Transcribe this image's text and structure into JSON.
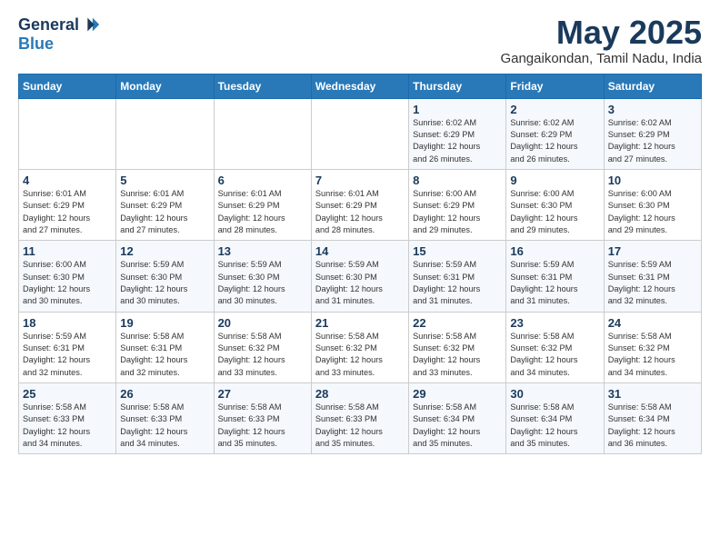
{
  "header": {
    "logo_general": "General",
    "logo_blue": "Blue",
    "title": "May 2025",
    "location": "Gangaikondan, Tamil Nadu, India"
  },
  "days_of_week": [
    "Sunday",
    "Monday",
    "Tuesday",
    "Wednesday",
    "Thursday",
    "Friday",
    "Saturday"
  ],
  "weeks": [
    [
      {
        "num": "",
        "info": ""
      },
      {
        "num": "",
        "info": ""
      },
      {
        "num": "",
        "info": ""
      },
      {
        "num": "",
        "info": ""
      },
      {
        "num": "1",
        "info": "Sunrise: 6:02 AM\nSunset: 6:29 PM\nDaylight: 12 hours\nand 26 minutes."
      },
      {
        "num": "2",
        "info": "Sunrise: 6:02 AM\nSunset: 6:29 PM\nDaylight: 12 hours\nand 26 minutes."
      },
      {
        "num": "3",
        "info": "Sunrise: 6:02 AM\nSunset: 6:29 PM\nDaylight: 12 hours\nand 27 minutes."
      }
    ],
    [
      {
        "num": "4",
        "info": "Sunrise: 6:01 AM\nSunset: 6:29 PM\nDaylight: 12 hours\nand 27 minutes."
      },
      {
        "num": "5",
        "info": "Sunrise: 6:01 AM\nSunset: 6:29 PM\nDaylight: 12 hours\nand 27 minutes."
      },
      {
        "num": "6",
        "info": "Sunrise: 6:01 AM\nSunset: 6:29 PM\nDaylight: 12 hours\nand 28 minutes."
      },
      {
        "num": "7",
        "info": "Sunrise: 6:01 AM\nSunset: 6:29 PM\nDaylight: 12 hours\nand 28 minutes."
      },
      {
        "num": "8",
        "info": "Sunrise: 6:00 AM\nSunset: 6:29 PM\nDaylight: 12 hours\nand 29 minutes."
      },
      {
        "num": "9",
        "info": "Sunrise: 6:00 AM\nSunset: 6:30 PM\nDaylight: 12 hours\nand 29 minutes."
      },
      {
        "num": "10",
        "info": "Sunrise: 6:00 AM\nSunset: 6:30 PM\nDaylight: 12 hours\nand 29 minutes."
      }
    ],
    [
      {
        "num": "11",
        "info": "Sunrise: 6:00 AM\nSunset: 6:30 PM\nDaylight: 12 hours\nand 30 minutes."
      },
      {
        "num": "12",
        "info": "Sunrise: 5:59 AM\nSunset: 6:30 PM\nDaylight: 12 hours\nand 30 minutes."
      },
      {
        "num": "13",
        "info": "Sunrise: 5:59 AM\nSunset: 6:30 PM\nDaylight: 12 hours\nand 30 minutes."
      },
      {
        "num": "14",
        "info": "Sunrise: 5:59 AM\nSunset: 6:30 PM\nDaylight: 12 hours\nand 31 minutes."
      },
      {
        "num": "15",
        "info": "Sunrise: 5:59 AM\nSunset: 6:31 PM\nDaylight: 12 hours\nand 31 minutes."
      },
      {
        "num": "16",
        "info": "Sunrise: 5:59 AM\nSunset: 6:31 PM\nDaylight: 12 hours\nand 31 minutes."
      },
      {
        "num": "17",
        "info": "Sunrise: 5:59 AM\nSunset: 6:31 PM\nDaylight: 12 hours\nand 32 minutes."
      }
    ],
    [
      {
        "num": "18",
        "info": "Sunrise: 5:59 AM\nSunset: 6:31 PM\nDaylight: 12 hours\nand 32 minutes."
      },
      {
        "num": "19",
        "info": "Sunrise: 5:58 AM\nSunset: 6:31 PM\nDaylight: 12 hours\nand 32 minutes."
      },
      {
        "num": "20",
        "info": "Sunrise: 5:58 AM\nSunset: 6:32 PM\nDaylight: 12 hours\nand 33 minutes."
      },
      {
        "num": "21",
        "info": "Sunrise: 5:58 AM\nSunset: 6:32 PM\nDaylight: 12 hours\nand 33 minutes."
      },
      {
        "num": "22",
        "info": "Sunrise: 5:58 AM\nSunset: 6:32 PM\nDaylight: 12 hours\nand 33 minutes."
      },
      {
        "num": "23",
        "info": "Sunrise: 5:58 AM\nSunset: 6:32 PM\nDaylight: 12 hours\nand 34 minutes."
      },
      {
        "num": "24",
        "info": "Sunrise: 5:58 AM\nSunset: 6:32 PM\nDaylight: 12 hours\nand 34 minutes."
      }
    ],
    [
      {
        "num": "25",
        "info": "Sunrise: 5:58 AM\nSunset: 6:33 PM\nDaylight: 12 hours\nand 34 minutes."
      },
      {
        "num": "26",
        "info": "Sunrise: 5:58 AM\nSunset: 6:33 PM\nDaylight: 12 hours\nand 34 minutes."
      },
      {
        "num": "27",
        "info": "Sunrise: 5:58 AM\nSunset: 6:33 PM\nDaylight: 12 hours\nand 35 minutes."
      },
      {
        "num": "28",
        "info": "Sunrise: 5:58 AM\nSunset: 6:33 PM\nDaylight: 12 hours\nand 35 minutes."
      },
      {
        "num": "29",
        "info": "Sunrise: 5:58 AM\nSunset: 6:34 PM\nDaylight: 12 hours\nand 35 minutes."
      },
      {
        "num": "30",
        "info": "Sunrise: 5:58 AM\nSunset: 6:34 PM\nDaylight: 12 hours\nand 35 minutes."
      },
      {
        "num": "31",
        "info": "Sunrise: 5:58 AM\nSunset: 6:34 PM\nDaylight: 12 hours\nand 36 minutes."
      }
    ]
  ]
}
